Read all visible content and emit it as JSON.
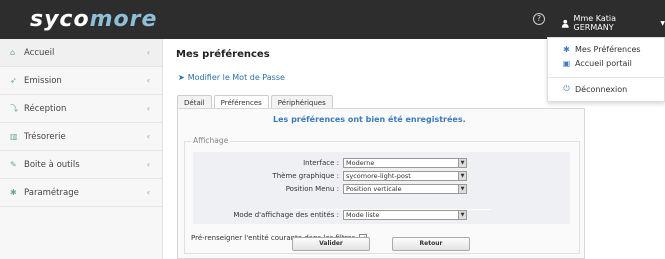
{
  "header": {
    "logo_part1": "syco",
    "logo_part2": "more",
    "help_icon": "?",
    "user_label": "Mme Katia GERMANY"
  },
  "sidebar": {
    "items": [
      {
        "label": "Accueil",
        "icon": "home-icon"
      },
      {
        "label": "Emission",
        "icon": "send-icon"
      },
      {
        "label": "Réception",
        "icon": "receive-icon"
      },
      {
        "label": "Trésorerie",
        "icon": "chart-icon"
      },
      {
        "label": "Boite à outils",
        "icon": "wrench-icon"
      },
      {
        "label": "Paramétrage",
        "icon": "gear-icon"
      }
    ]
  },
  "main": {
    "title": "Mes préférences",
    "change_password_link": "Modifier le Mot de Passe",
    "tabs": [
      "Détail",
      "Préférences",
      "Périphériques"
    ],
    "success_message": "Les préférences ont bien été enregistrées.",
    "fieldset_legend": "Affichage",
    "fields": [
      {
        "label": "Interface :",
        "value": "Moderne"
      },
      {
        "label": "Thème graphique :",
        "value": "sycomore-light-post"
      },
      {
        "label": "Position Menu :",
        "value": "Position verticale"
      },
      {
        "label": "Mode d'affichage des entités :",
        "value": "Mode liste"
      }
    ],
    "prefill_label": "Pré-renseigner l'entité courante dans les filtres",
    "prefill_checked": true,
    "validate_button": "Valider",
    "back_button": "Retour"
  },
  "dropdown": {
    "items": [
      "Mes Préférences",
      "Accueil portail",
      "Déconnexion"
    ]
  },
  "colors": {
    "header_bg": "#2d2d2d",
    "accent": "#3b7bbf"
  }
}
